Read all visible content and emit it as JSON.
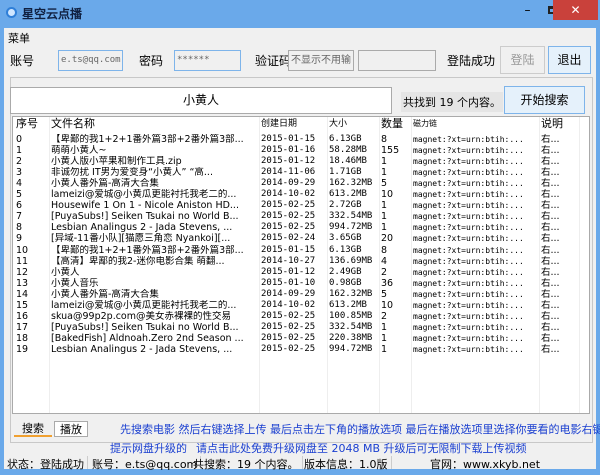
{
  "window": {
    "title": "星空云点播",
    "min": "–",
    "close": "✕"
  },
  "menu": {
    "label": "菜单"
  },
  "login": {
    "account_label": "账号",
    "account_value": "e.ts@qq.com",
    "password_label": "密码",
    "password_value": "******",
    "captcha_label": "验证码",
    "captcha_value": "不显示不用输",
    "captcha_image": "",
    "status": "登陆成功",
    "login_button": "登陆",
    "logout_button": "退出"
  },
  "search": {
    "query": "小黄人",
    "result_text": "共找到 19 个内容。",
    "search_button": "开始搜索"
  },
  "table": {
    "headers": [
      "序号",
      "文件名称",
      "创建日期",
      "大小",
      "数量",
      "磁力链",
      "说明"
    ],
    "rows": [
      [
        "0",
        "【卑鄙的我1+2+1番外篇3部+2番外篇3部...",
        "2015-01-15",
        "6.13GB",
        "8",
        "magnet:?xt=urn:btih:...",
        "右..."
      ],
      [
        "1",
        "萌萌小黄人~",
        "2015-01-16",
        "58.28MB",
        "155",
        "magnet:?xt=urn:btih:...",
        "右..."
      ],
      [
        "2",
        "小黄人版小苹果和制作工具.zip",
        "2015-01-12",
        "18.46MB",
        "1",
        "magnet:?xt=urn:btih:...",
        "右..."
      ],
      [
        "3",
        "非诚勿扰 IT男为爱变身“小黄人” “高...",
        "2014-11-06",
        "1.71GB",
        "1",
        "magnet:?xt=urn:btih:...",
        "右..."
      ],
      [
        "4",
        "小黄人番外篇-高清大合集",
        "2014-09-29",
        "162.32MB",
        "5",
        "magnet:?xt=urn:btih:...",
        "右..."
      ],
      [
        "5",
        "lameizi@爱城@小黄瓜更能衬托我老二的...",
        "2014-10-02",
        "613.2MB",
        "10",
        "magnet:?xt=urn:btih:...",
        "右..."
      ],
      [
        "6",
        "Housewife 1 On 1 - Nicole Aniston HD...",
        "2015-02-25",
        "2.72GB",
        "1",
        "magnet:?xt=urn:btih:...",
        "右..."
      ],
      [
        "7",
        "[PuyaSubs!] Seiken Tsukai no World B...",
        "2015-02-25",
        "332.54MB",
        "1",
        "magnet:?xt=urn:btih:...",
        "右..."
      ],
      [
        "8",
        "Lesbian Analingus 2 - Jada Stevens, ...",
        "2015-02-25",
        "994.72MB",
        "1",
        "magnet:?xt=urn:btih:...",
        "右..."
      ],
      [
        "9",
        "[异域-11番小队][猫愿三角恋 Nyankoi][...",
        "2015-02-24",
        "3.65GB",
        "20",
        "magnet:?xt=urn:btih:...",
        "右..."
      ],
      [
        "10",
        "【卑鄙的我1+2+1番外篇3部+2番外篇3部...",
        "2015-01-15",
        "6.13GB",
        "8",
        "magnet:?xt=urn:btih:...",
        "右..."
      ],
      [
        "11",
        "【高清】卑鄙的我2-迷你电影合集 萌翻...",
        "2014-10-27",
        "136.69MB",
        "4",
        "magnet:?xt=urn:btih:...",
        "右..."
      ],
      [
        "12",
        "小黄人",
        "2015-01-12",
        "2.49GB",
        "2",
        "magnet:?xt=urn:btih:...",
        "右..."
      ],
      [
        "13",
        "小黄人音乐",
        "2015-01-10",
        "0.98GB",
        "36",
        "magnet:?xt=urn:btih:...",
        "右..."
      ],
      [
        "14",
        "小黄人番外篇-高清大合集",
        "2014-09-29",
        "162.32MB",
        "5",
        "magnet:?xt=urn:btih:...",
        "右..."
      ],
      [
        "15",
        "lameizi@爱城@小黄瓜更能衬托我老二的...",
        "2014-10-02",
        "613.2MB",
        "10",
        "magnet:?xt=urn:btih:...",
        "右..."
      ],
      [
        "16",
        "skua@99p2p.com@美女赤裸裸的性交易",
        "2015-02-25",
        "100.85MB",
        "2",
        "magnet:?xt=urn:btih:...",
        "右..."
      ],
      [
        "17",
        "[PuyaSubs!] Seiken Tsukai no World B...",
        "2015-02-25",
        "332.54MB",
        "1",
        "magnet:?xt=urn:btih:...",
        "右..."
      ],
      [
        "18",
        "[BakedFish] Aldnoah.Zero 2nd Season ...",
        "2015-02-25",
        "220.38MB",
        "1",
        "magnet:?xt=urn:btih:...",
        "右..."
      ],
      [
        "19",
        "Lesbian Analingus 2 - Jada Stevens, ...",
        "2015-02-25",
        "994.72MB",
        "1",
        "magnet:?xt=urn:btih:...",
        "右..."
      ]
    ]
  },
  "tabs": [
    {
      "label": "搜索",
      "active": true
    },
    {
      "label": "播放",
      "active": false
    }
  ],
  "hints": {
    "line1": "先搜索电影 然后右键选择上传 最后点击左下角的播放选项 最后在播放选项里选择你要看的电影右键播放",
    "line2_a": "提示网盘升级的",
    "line2_b": "请点击此处免费升级网盘至 2048 MB 升级后可无限制下载上传视频"
  },
  "statusbar": [
    "状态：登陆成功",
    "账号：e.ts@qq.com",
    "共搜索：19 个内容。",
    "版本信息：1.0版",
    "官网：www.xkyb.net"
  ],
  "colors": {
    "titlebar": "#6aa9ea",
    "close": "#c9413b",
    "hint": "#1a3fd0"
  }
}
